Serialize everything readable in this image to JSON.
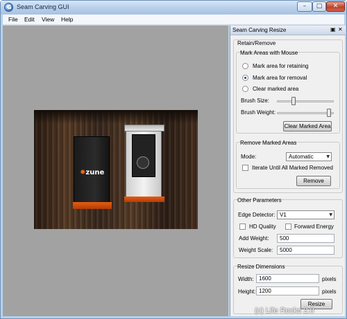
{
  "window": {
    "title": "Seam Carving GUI",
    "controls": {
      "minimize": "–",
      "maximize": "□",
      "close": "✕"
    },
    "app_icon_letter": "G"
  },
  "menu": {
    "items": [
      "File",
      "Edit",
      "View",
      "Help"
    ]
  },
  "canvas": {
    "background": "#a2a2a2",
    "zune_text": "zune"
  },
  "panel": {
    "title": "Seam Carving Resize",
    "dock_glyph": "▣",
    "close_glyph": "✕",
    "retain_remove": {
      "label": "Retain/Remove",
      "mark_areas": {
        "label": "Mark Areas with Mouse",
        "options": [
          "Mark area for retaining",
          "Mark area for removal",
          "Clear marked area"
        ],
        "selected": "Mark area for removal",
        "brush_size_label": "Brush Size:",
        "brush_size_level": 0.32,
        "brush_weight_label": "Brush Weight:",
        "brush_weight_level": 1.0,
        "clear_button": "Clear Marked Area"
      },
      "remove_marked": {
        "label": "Remove Marked Areas",
        "mode_label": "Mode:",
        "mode_value": "Automatic",
        "iterate_label": "Iterate Until All Marked Removed",
        "iterate_checked": false,
        "remove_button": "Remove"
      }
    },
    "other_params": {
      "label": "Other Parameters",
      "edge_detector_label": "Edge Detector:",
      "edge_detector_value": "V1",
      "hd_quality_label": "HD Quality",
      "hd_quality_checked": false,
      "forward_energy_label": "Forward Energy",
      "forward_energy_checked": false,
      "add_weight_label": "Add Weight:",
      "add_weight_value": "500",
      "weight_scale_label": "Weight Scale:",
      "weight_scale_value": "5000"
    },
    "resize_dimensions": {
      "label": "Resize Dimensions",
      "width_label": "Width:",
      "width_value": "1600",
      "width_unit": "pixels",
      "height_label": "Height:",
      "height_value": "1200",
      "height_unit": "pixels",
      "resize_button": "Resize"
    }
  },
  "watermark": "(c) Life Rocks 2.0"
}
